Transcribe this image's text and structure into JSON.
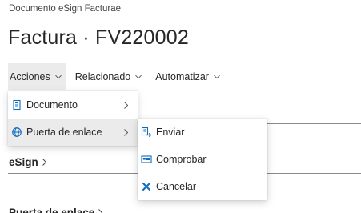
{
  "header": {
    "caption": "Documento eSign Facturae",
    "title": "Factura · FV220002"
  },
  "action_bar": {
    "tabs": [
      {
        "label": "Acciones",
        "active": true
      },
      {
        "label": "Relacionado",
        "active": false
      },
      {
        "label": "Automatizar",
        "active": false
      }
    ]
  },
  "acciones_menu": {
    "items": [
      {
        "label": "Documento",
        "icon": "document-icon",
        "has_submenu": true
      },
      {
        "label": "Puerta de enlace",
        "icon": "globe-icon",
        "has_submenu": true,
        "highlighted": true
      }
    ]
  },
  "gateway_submenu": {
    "items": [
      {
        "label": "Enviar",
        "icon": "send-icon"
      },
      {
        "label": "Comprobar",
        "icon": "check-card-icon"
      },
      {
        "label": "Cancelar",
        "icon": "cancel-x-icon"
      }
    ]
  },
  "sections": {
    "esign": "eSign",
    "gateway": "Puerta de enlace"
  },
  "colors": {
    "accent": "#0f6cbd",
    "cancel": "#0f6cbd",
    "hover_bg": "#ebebeb",
    "text": "#262626"
  }
}
